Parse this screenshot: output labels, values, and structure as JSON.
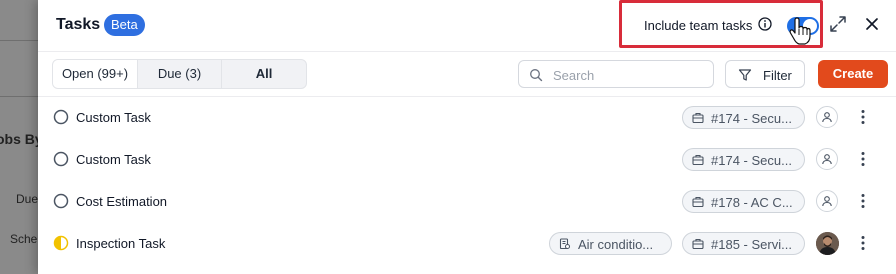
{
  "background": {
    "texts": [
      "obs By",
      "Due",
      "Sche"
    ]
  },
  "panel": {
    "title": "Tasks",
    "badge": "Beta",
    "include_team_tasks": {
      "label": "Include team tasks",
      "enabled": true
    },
    "icons": {
      "info": "info-icon",
      "expand": "expand-icon",
      "close": "close-icon",
      "cursor": "hand-pointer-icon"
    }
  },
  "toolbar": {
    "tabs": [
      {
        "label": "Open (99+)",
        "active": true
      },
      {
        "label": "Due (3)",
        "active": false
      },
      {
        "label": "All",
        "active": false
      }
    ],
    "search": {
      "placeholder": "Search",
      "value": ""
    },
    "filter_label": "Filter",
    "create_label": "Create"
  },
  "tasks": [
    {
      "name": "Custom Task",
      "status": "open",
      "project": "#174 - Secu...",
      "asset": null,
      "assignee": "unassigned"
    },
    {
      "name": "Custom Task",
      "status": "open",
      "project": "#174 - Secu...",
      "asset": null,
      "assignee": "unassigned"
    },
    {
      "name": "Cost Estimation",
      "status": "open",
      "project": "#178 - AC C...",
      "asset": null,
      "assignee": "unassigned"
    },
    {
      "name": "Inspection Task",
      "status": "in-progress",
      "project": "#185 - Servi...",
      "asset": "Air conditio...",
      "assignee": "photo"
    }
  ],
  "colors": {
    "accent": "#2f6fe0",
    "create": "#e24a1c",
    "highlight": "#d82c3a",
    "in_progress": "#f2c200"
  }
}
